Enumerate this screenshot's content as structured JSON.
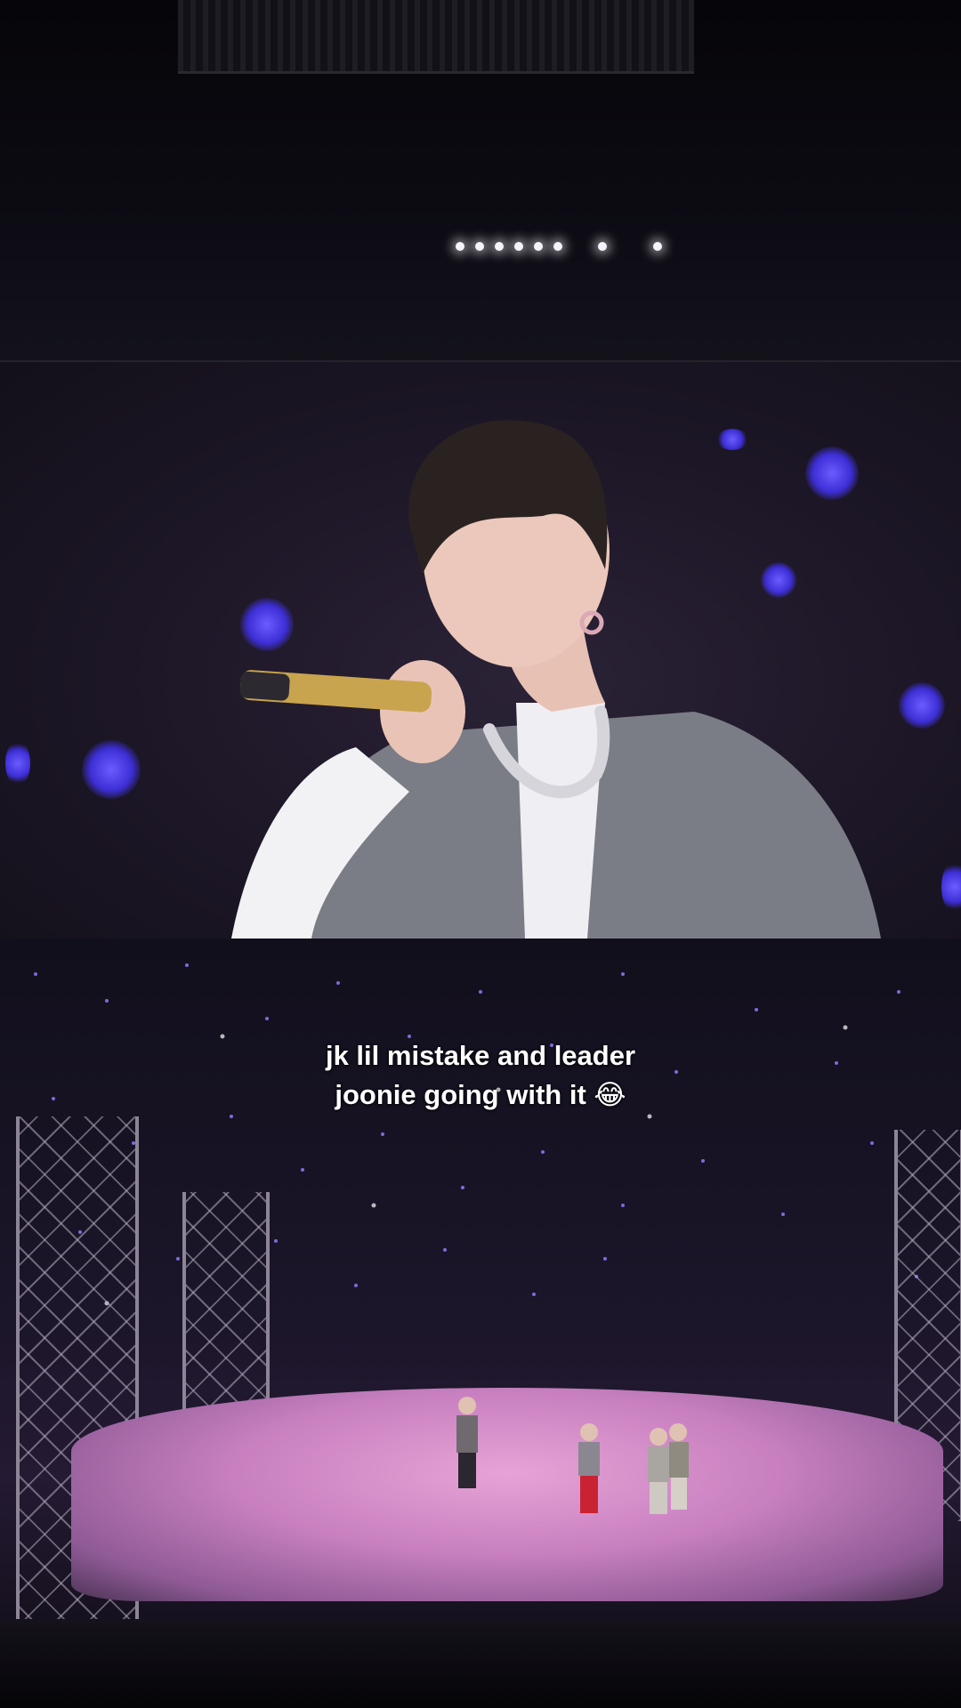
{
  "caption": {
    "line1": "jk lil mistake and leader",
    "line2": "joonie going with it 😂"
  },
  "colors": {
    "screen_glow": "#2b2236",
    "bokeh_blue": "#3d2fd6",
    "stage_pink": "#e7a3d6",
    "caption_text": "#ffffff"
  }
}
